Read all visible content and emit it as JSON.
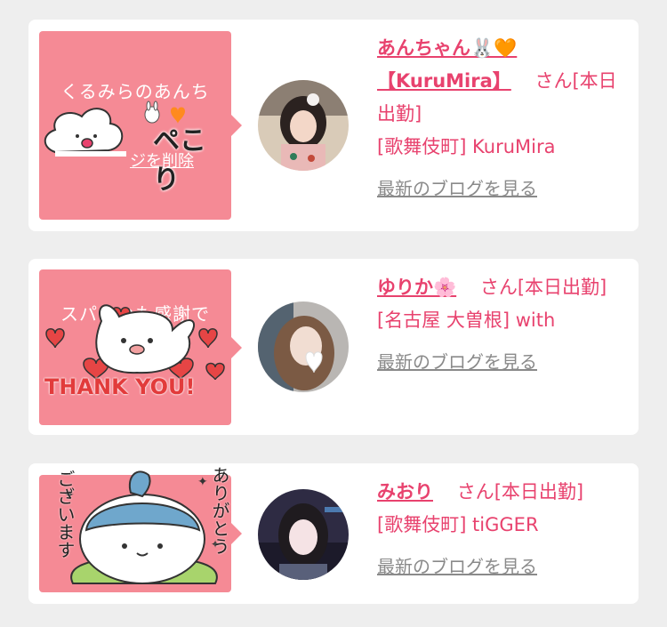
{
  "colors": {
    "background": "#eeeeee",
    "card": "#ffffff",
    "sticker_bg": "#f58a95",
    "accent_pink": "#e8426e",
    "muted_link": "#8a8a8a"
  },
  "cards": [
    {
      "sticker": {
        "caption": "くるみらのあんち",
        "overlay_text": "ペこり",
        "sub_text": "ジを削除",
        "icon": "rabbit-heart-icon"
      },
      "name": "あんちゃん🐰🧡【KuruMira】",
      "honorific": "さん",
      "status": "[本日出勤]",
      "location": "[歌舞伎町] KuruMira",
      "blog_link": "最新のブログを見る"
    },
    {
      "sticker": {
        "caption": "スパいつも感謝で",
        "overlay_text": "THANK YOU!",
        "icon": "heart-icon"
      },
      "name": "ゆりか🌸",
      "honorific": "さん",
      "status": "[本日出勤]",
      "location": "[名古屋 大曽根] with",
      "blog_link": "最新のブログを見る"
    },
    {
      "sticker": {
        "left_text": "ございます",
        "right_text": "ありがとう"
      },
      "name": "みおり",
      "honorific": "さん",
      "status": "[本日出勤]",
      "location": "[歌舞伎町] tiGGER",
      "blog_link": "最新のブログを見る"
    }
  ]
}
